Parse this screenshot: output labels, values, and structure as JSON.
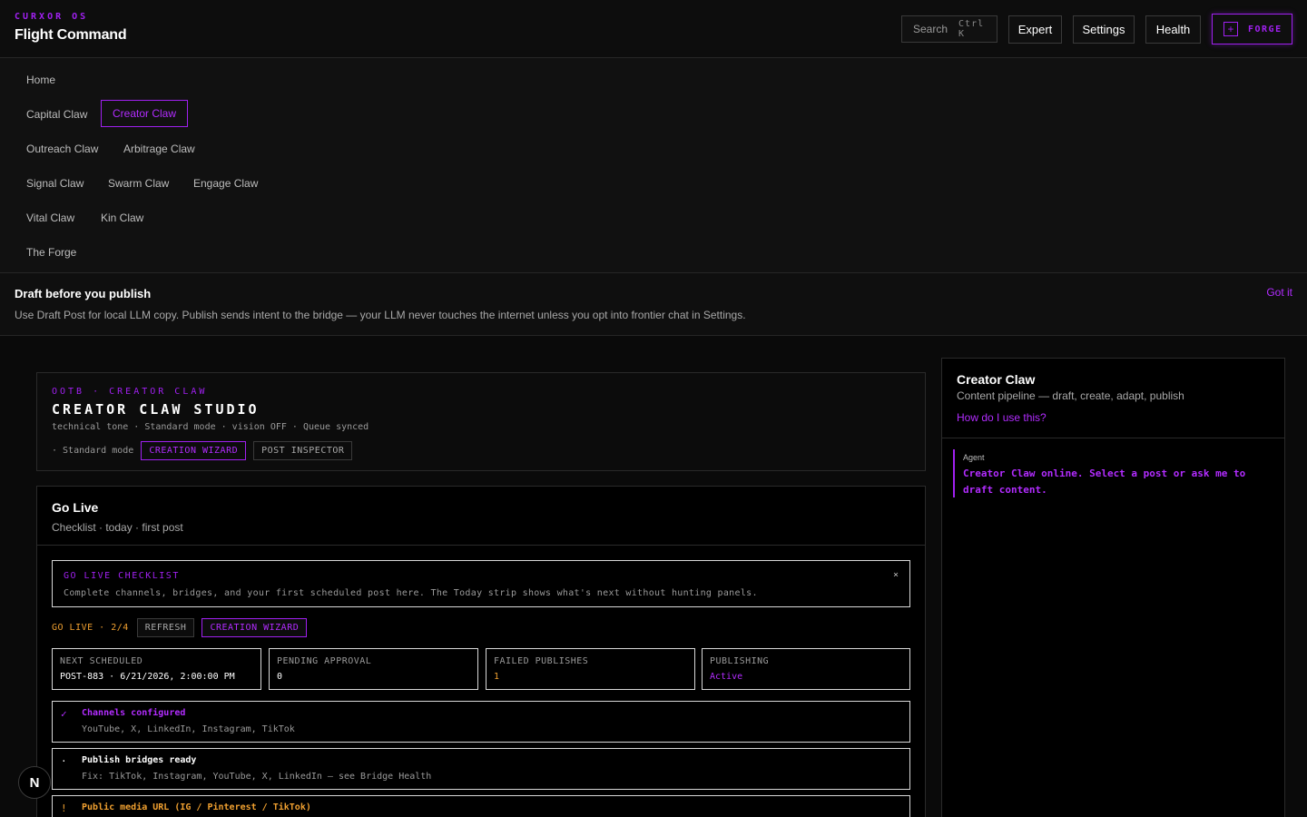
{
  "header": {
    "kicker": "CURXOR OS",
    "title": "Flight Command",
    "search_label": "Search",
    "search_shortcut": "Ctrl K",
    "expert_label": "Expert",
    "settings_label": "Settings",
    "health_label": "Health",
    "forge_icon": "plus-icon",
    "forge_plus": "+",
    "forge_label": "FORGE"
  },
  "nav": {
    "home": "Home",
    "capital": "Capital Claw",
    "creator": "Creator Claw",
    "outreach": "Outreach Claw",
    "arbitrage": "Arbitrage Claw",
    "signal": "Signal Claw",
    "swarm": "Swarm Claw",
    "engage": "Engage Claw",
    "vital": "Vital Claw",
    "kin": "Kin Claw",
    "forge": "The Forge",
    "active": "Creator Claw"
  },
  "banner": {
    "title": "Draft before you publish",
    "text": "Use Draft Post for local LLM copy. Publish sends intent to the bridge — your LLM never touches the internet unless you opt into frontier chat in Settings.",
    "dismiss": "Got it"
  },
  "studio": {
    "kicker": "OOTB · CREATOR CLAW",
    "title": "CREATOR CLAW STUDIO",
    "meta": "technical tone · Standard mode · vision OFF · Queue synced",
    "mode": "· Standard mode",
    "wizard_label": "CREATION WIZARD",
    "inspector_label": "POST INSPECTOR"
  },
  "golive": {
    "title": "Go Live",
    "subtitle": "Checklist · today · first post",
    "checklist_title": "GO LIVE CHECKLIST",
    "checklist_close": "×",
    "checklist_text": "Complete channels, bridges, and your first scheduled post here. The Today strip shows what's next without hunting panels.",
    "progress": "GO LIVE · 2/4",
    "refresh_label": "REFRESH",
    "wizard_label": "CREATION WIZARD",
    "stats": [
      {
        "label": "NEXT SCHEDULED",
        "value": "POST-883 · 6/21/2026, 2:00:00 PM"
      },
      {
        "label": "PENDING APPROVAL",
        "value": "0"
      },
      {
        "label": "FAILED PUBLISHES",
        "value": "1"
      },
      {
        "label": "PUBLISHING",
        "value": "Active"
      }
    ],
    "items": [
      {
        "mark": "✓",
        "title": "Channels configured",
        "detail": "YouTube, X, LinkedIn, Instagram, TikTok"
      },
      {
        "mark": "·",
        "title": "Publish bridges ready",
        "detail": "Fix: TikTok, Instagram, YouTube, X, LinkedIn — see Bridge Health"
      },
      {
        "mark": "!",
        "title": "Public media URL (IG / Pinterest / TikTok)",
        "detail": ""
      }
    ]
  },
  "side": {
    "title": "Creator Claw",
    "subtitle": "Content pipeline — draft, create, adapt, publish",
    "help": "How do I use this?",
    "message_role": "Agent",
    "message_text": "Creator Claw online. Select a post or ask me to draft content."
  },
  "badge": {
    "letter": "N"
  },
  "colors": {
    "accent": "#a020f0",
    "accent_text": "#b22cff",
    "warning": "#f0a030",
    "background": "#0a0a0a"
  }
}
